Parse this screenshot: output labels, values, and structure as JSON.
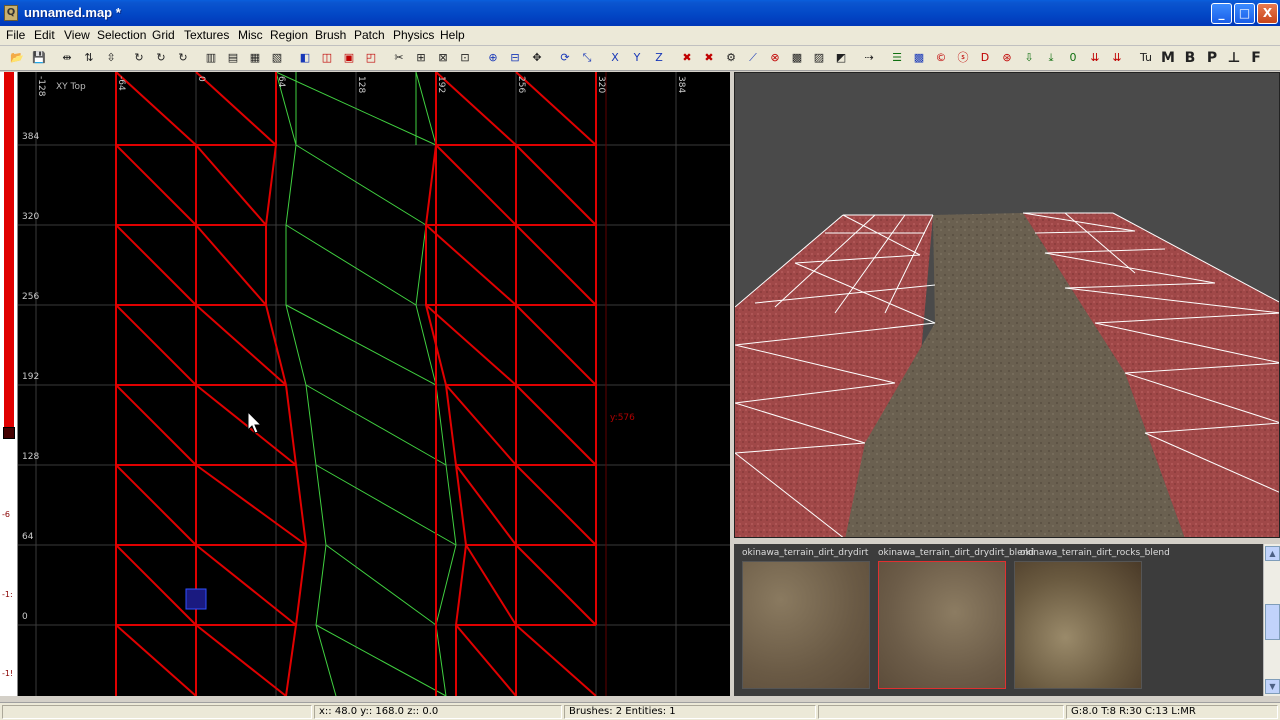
{
  "window": {
    "title": "unnamed.map *",
    "app_icon": "q3-icon"
  },
  "window_controls": {
    "minimize": "_",
    "maximize": "□",
    "close": "X"
  },
  "menu": [
    "File",
    "Edit",
    "View",
    "Selection",
    "Grid",
    "Textures",
    "Misc",
    "Region",
    "Brush",
    "Patch",
    "Physics",
    "Help"
  ],
  "toolbar": {
    "icons": [
      "open-icon",
      "save-icon",
      "flip-x-icon",
      "flip-y-icon",
      "flip-z-icon",
      "rotate-x-icon",
      "rotate-y-icon",
      "rotate-z-icon",
      "select-complete-tall-icon",
      "select-touching-icon",
      "select-partial-tall-icon",
      "select-inside-icon",
      "csg-subtract-icon",
      "csg-hollow-icon",
      "csg-make-room-icon",
      "csg-merge-icon",
      "clipper-icon",
      "change-views-icon",
      "cubic-clip-icon",
      "camera-icon",
      "texture-lock-icon",
      "scale-lock-icon",
      "move-icon",
      "rotate-icon",
      "x-axis-icon",
      "y-axis-icon",
      "z-axis-icon",
      "patch-cap-icon",
      "patch-weld-icon",
      "patch-drill-icon",
      "patch-bend-icon",
      "patch-insert-icon",
      "patch-delete-icon",
      "patch-show-icon",
      "patch-tesselate-icon",
      "patch-redisperse-icon",
      "entity-list-icon",
      "show-curves-icon",
      "show-caulk-icon",
      "show-clip-icon",
      "show-detail-icon",
      "show-lights-icon",
      "down-arrow-icon",
      "drop-to-floor-icon",
      "zero-icon",
      "pull-down-icon",
      "push-down-icon"
    ],
    "text_buttons": [
      "Tu",
      "M",
      "B",
      "P",
      "⊥",
      "F"
    ]
  },
  "view2d": {
    "label": "XY Top",
    "coord_readout": "y:576",
    "x_ticks": [
      "-128",
      "-64",
      "0",
      "64",
      "128",
      "192",
      "256",
      "320",
      "384"
    ],
    "y_ticks": [
      "384",
      "320",
      "256",
      "192",
      "128",
      "64",
      "0"
    ],
    "scale_labels": [
      "-6",
      "-1:",
      "-1!"
    ]
  },
  "texture_browser": {
    "textures": [
      {
        "name": "okinawa_terrain_dirt_drydirt",
        "selected": false
      },
      {
        "name": "okinawa_terrain_dirt_drydirt_blend",
        "selected": true
      },
      {
        "name": "okinawa_terrain_dirt_rocks_blend",
        "selected": false
      }
    ],
    "scroll_up": "▲",
    "scroll_down": "▼"
  },
  "status": {
    "coords": "x:: 48.0  y:: 168.0  z:: 0.0",
    "counts": "Brushes: 2 Entities: 1",
    "grid": "G:8.0 T:8 R:30 C:13 L:MR"
  },
  "colors": {
    "titlebar": "#0349c7",
    "grid_line": "#3a3a3a",
    "brush_red": "#e00000",
    "patch_green": "#50e050",
    "terrain_red": "#a04848",
    "dirt": "#6a6050"
  }
}
